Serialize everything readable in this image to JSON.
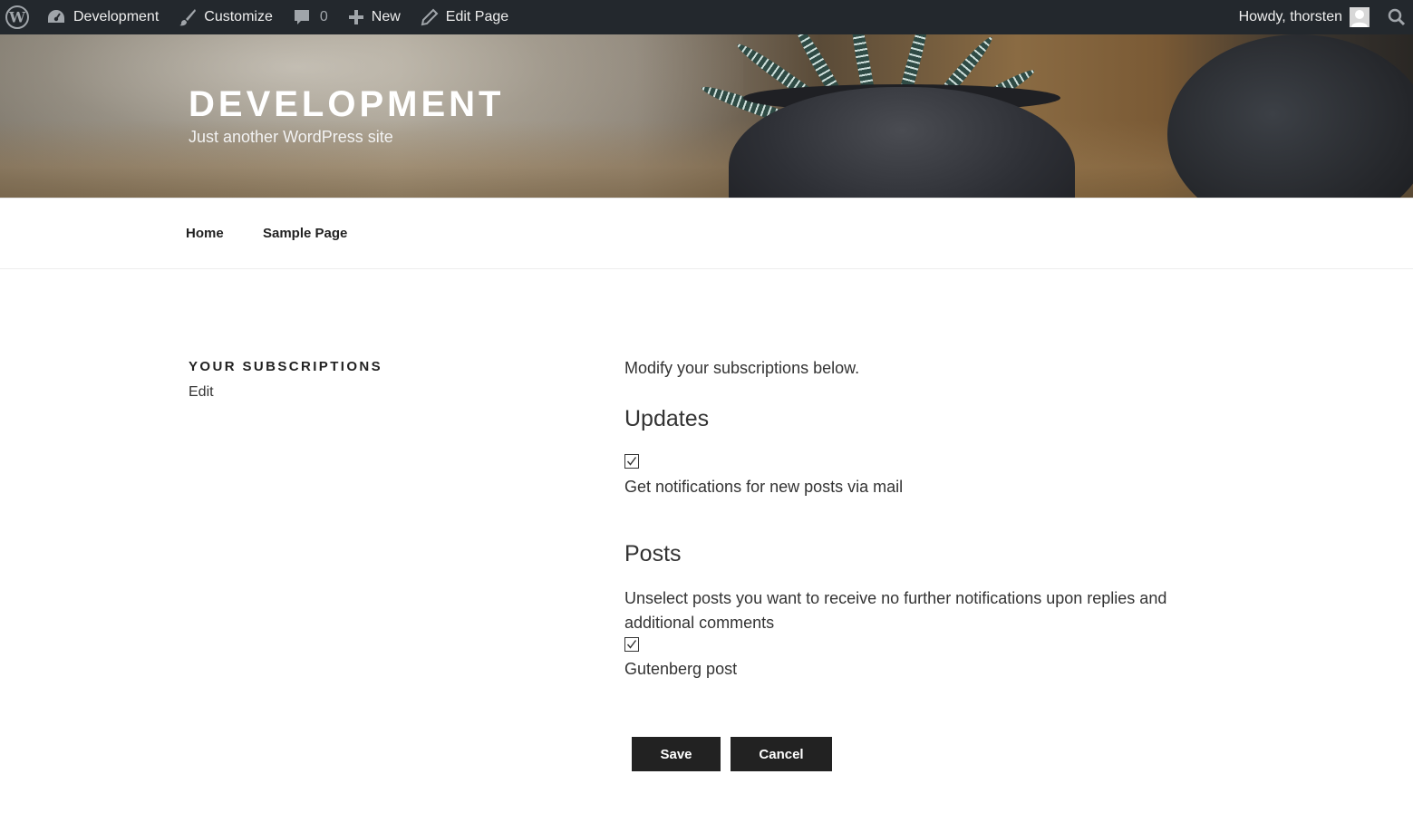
{
  "adminbar": {
    "site_name": "Development",
    "customize": "Customize",
    "comments_count": "0",
    "new": "New",
    "edit_page": "Edit Page",
    "howdy": "Howdy, thorsten"
  },
  "header": {
    "site_title": "DEVELOPMENT",
    "site_description": "Just another WordPress site"
  },
  "nav": {
    "items": [
      {
        "label": "Home"
      },
      {
        "label": "Sample Page"
      }
    ]
  },
  "sidebar": {
    "title": "YOUR SUBSCRIPTIONS",
    "edit": "Edit"
  },
  "main": {
    "intro": "Modify your subscriptions below.",
    "updates_heading": "Updates",
    "updates_checkbox_label": "Get notifications for new posts via mail",
    "updates_checked": true,
    "posts_heading": "Posts",
    "posts_description": "Unselect posts you want to receive no further notifications upon replies and additional comments",
    "post_checkbox_label": "Gutenberg post",
    "post_checked": true
  },
  "buttons": {
    "save": "Save",
    "cancel": "Cancel"
  },
  "colors": {
    "adminbar_bg": "#23282d",
    "button_bg": "#222222"
  }
}
